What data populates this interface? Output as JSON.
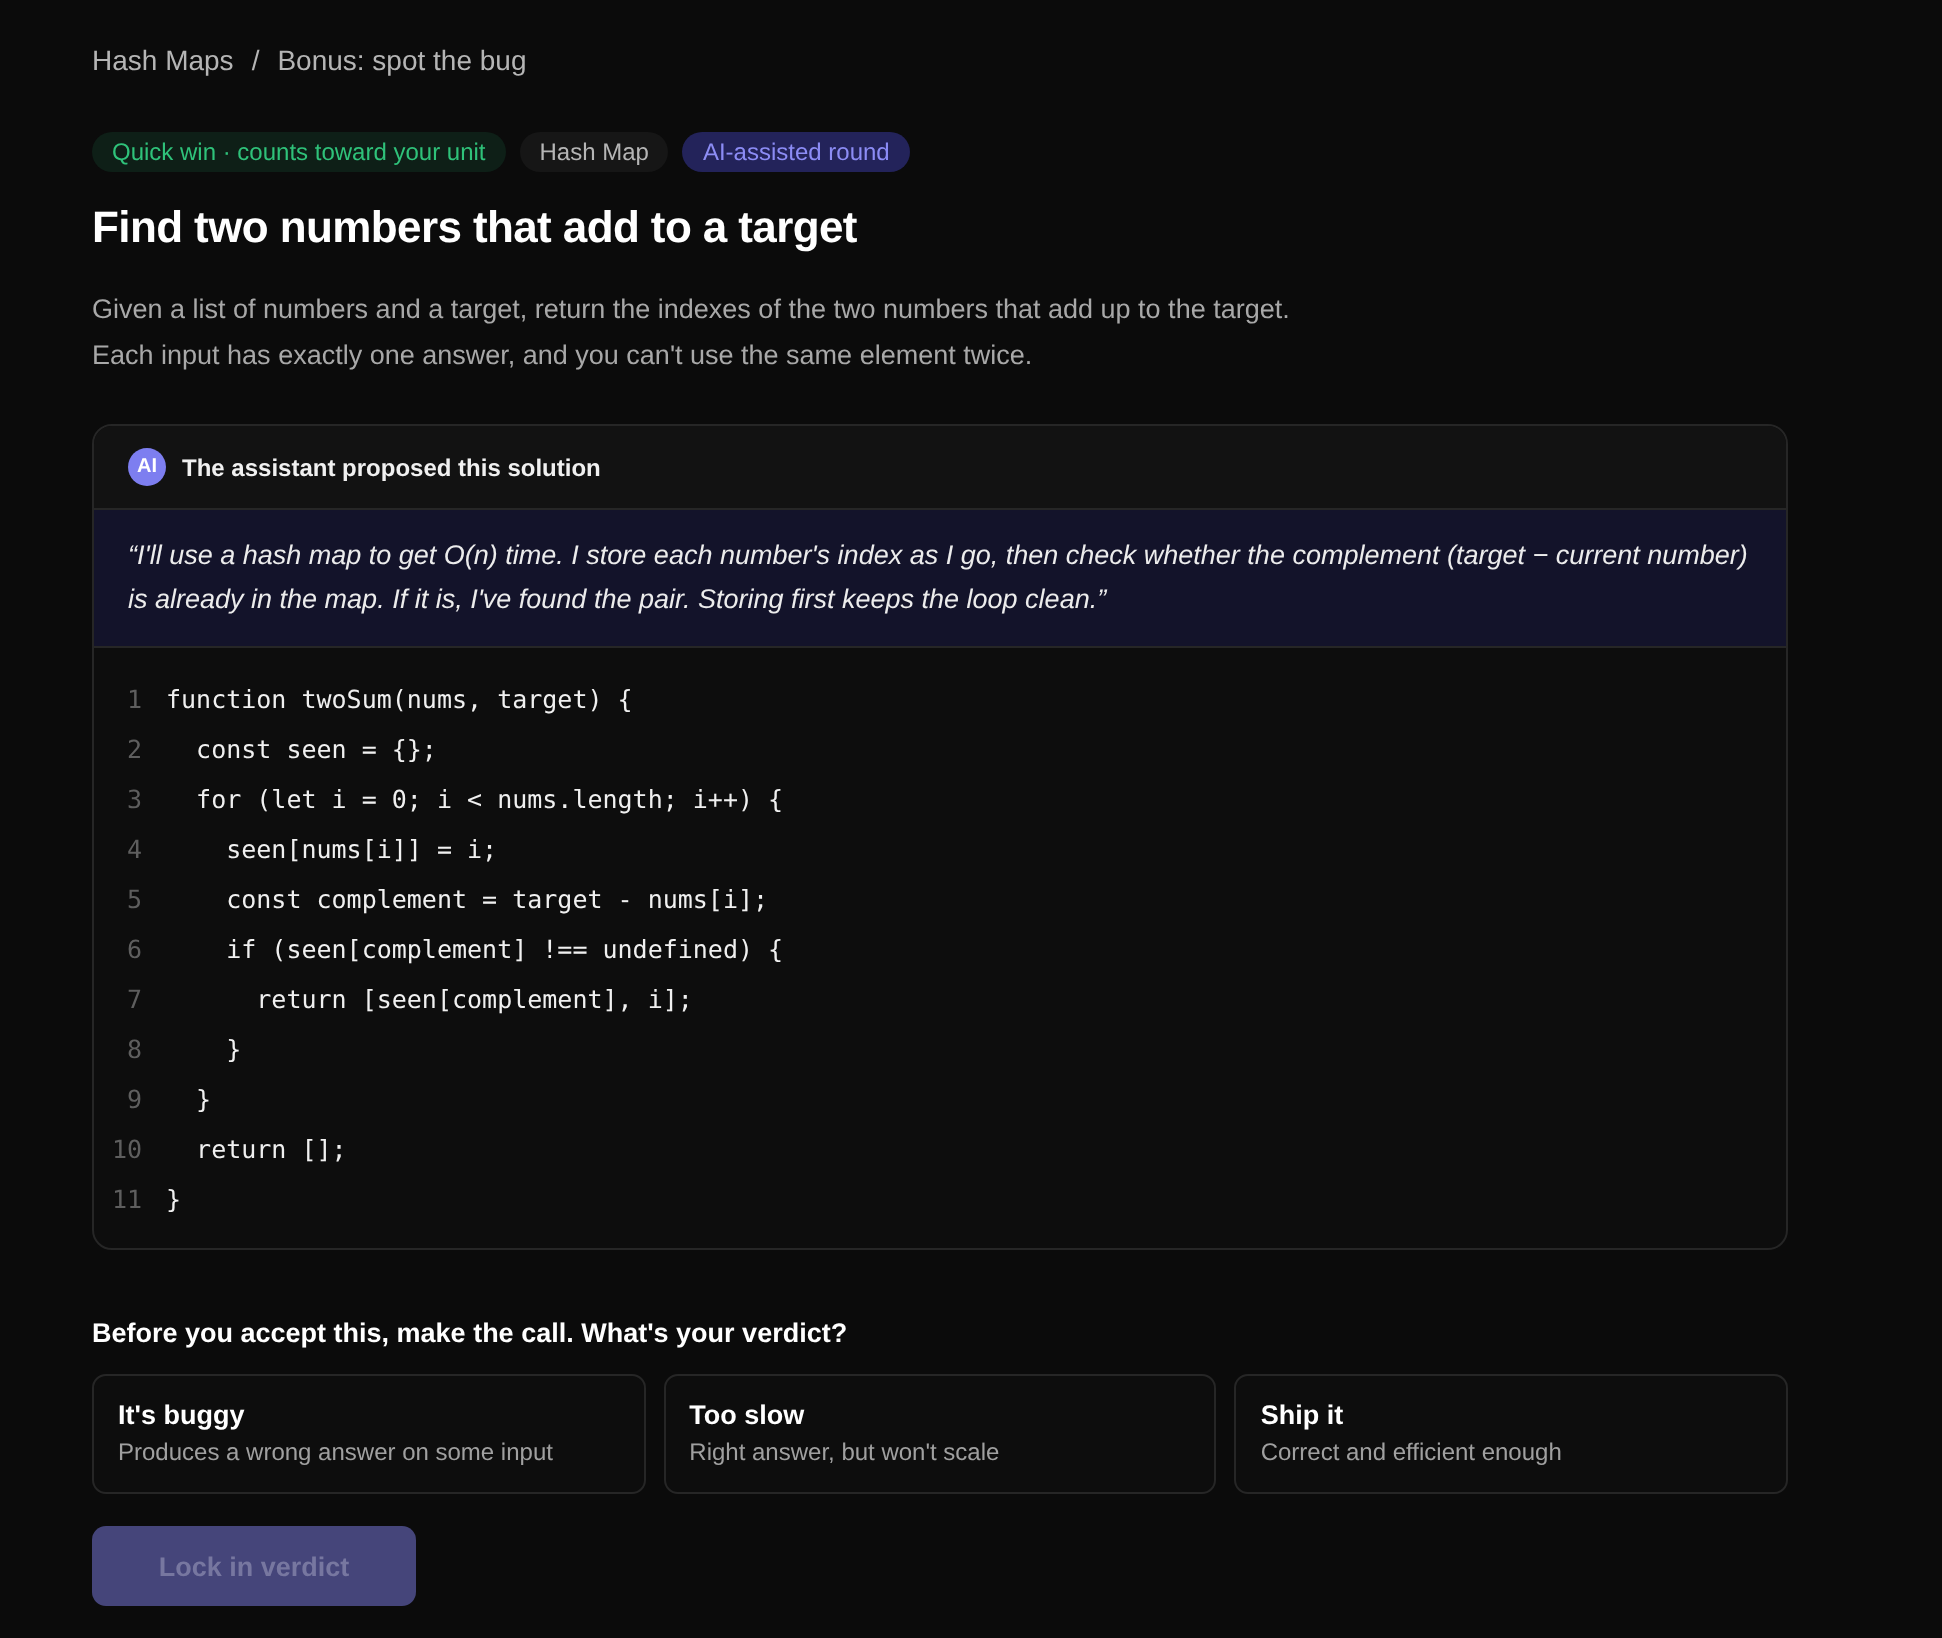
{
  "breadcrumb": [
    {
      "label": "Hash Maps"
    },
    {
      "label": "/"
    },
    {
      "label": "Bonus: spot the bug"
    }
  ],
  "badges": [
    {
      "label": "Quick win · counts toward your unit",
      "kind": "success"
    },
    {
      "label": "Hash Map",
      "kind": "neutral"
    },
    {
      "label": "AI-assisted round",
      "kind": "ai"
    }
  ],
  "title": "Find two numbers that add to a target",
  "description": [
    "Given a list of numbers and a target, return the indexes of the two numbers that add up to the target.",
    "Each input has exactly one answer, and you can't use the same element twice."
  ],
  "proposal": {
    "avatar": "AI",
    "heading": "The assistant proposed this solution",
    "quote": "“I'll use a hash map to get O(n) time. I store each number's index as I go, then check whether the complement (target − current number) is already in the map. If it is, I've found the pair. Storing first keeps the loop clean.”",
    "code": [
      {
        "number": "1",
        "text": "function twoSum(nums, target) {"
      },
      {
        "number": "2",
        "text": "  const seen = {};"
      },
      {
        "number": "3",
        "text": "  for (let i = 0; i < nums.length; i++) {"
      },
      {
        "number": "4",
        "text": "    seen[nums[i]] = i;"
      },
      {
        "number": "5",
        "text": "    const complement = target - nums[i];"
      },
      {
        "number": "6",
        "text": "    if (seen[complement] !== undefined) {"
      },
      {
        "number": "7",
        "text": "      return [seen[complement], i];"
      },
      {
        "number": "8",
        "text": "    }"
      },
      {
        "number": "9",
        "text": "  }"
      },
      {
        "number": "10",
        "text": "  return [];"
      },
      {
        "number": "11",
        "text": "}"
      }
    ]
  },
  "question": "Before you accept this, make the call. What's your verdict?",
  "options": [
    {
      "title": "It's buggy",
      "subtitle": "Produces a wrong answer on some input",
      "selected": false
    },
    {
      "title": "Too slow",
      "subtitle": "Right answer, but won't scale",
      "selected": false
    },
    {
      "title": "Ship it",
      "subtitle": "Correct and efficient enough",
      "selected": false
    }
  ],
  "submit": {
    "label": "Lock in verdict",
    "disabled": true
  }
}
